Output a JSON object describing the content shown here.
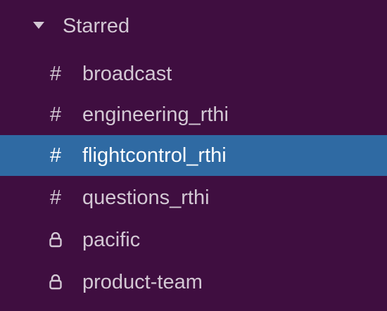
{
  "section": {
    "label": "Starred",
    "expanded": true,
    "caret_icon": "caret-down-icon"
  },
  "channels": [
    {
      "icon": "hash-icon",
      "icon_glyph": "#",
      "name": "broadcast",
      "selected": false
    },
    {
      "icon": "hash-icon",
      "icon_glyph": "#",
      "name": "engineering_rthi",
      "selected": false
    },
    {
      "icon": "hash-icon",
      "icon_glyph": "#",
      "name": "flightcontrol_rthi",
      "selected": true
    },
    {
      "icon": "hash-icon",
      "icon_glyph": "#",
      "name": "questions_rthi",
      "selected": false
    },
    {
      "icon": "lock-icon",
      "name": "pacific",
      "selected": false
    },
    {
      "icon": "lock-icon",
      "name": "product-team",
      "selected": false
    }
  ],
  "colors": {
    "sidebar_background": "#3f0e40",
    "selected_background": "#2f6aa3",
    "text": "#d3c8d4",
    "selected_text": "#ffffff"
  }
}
